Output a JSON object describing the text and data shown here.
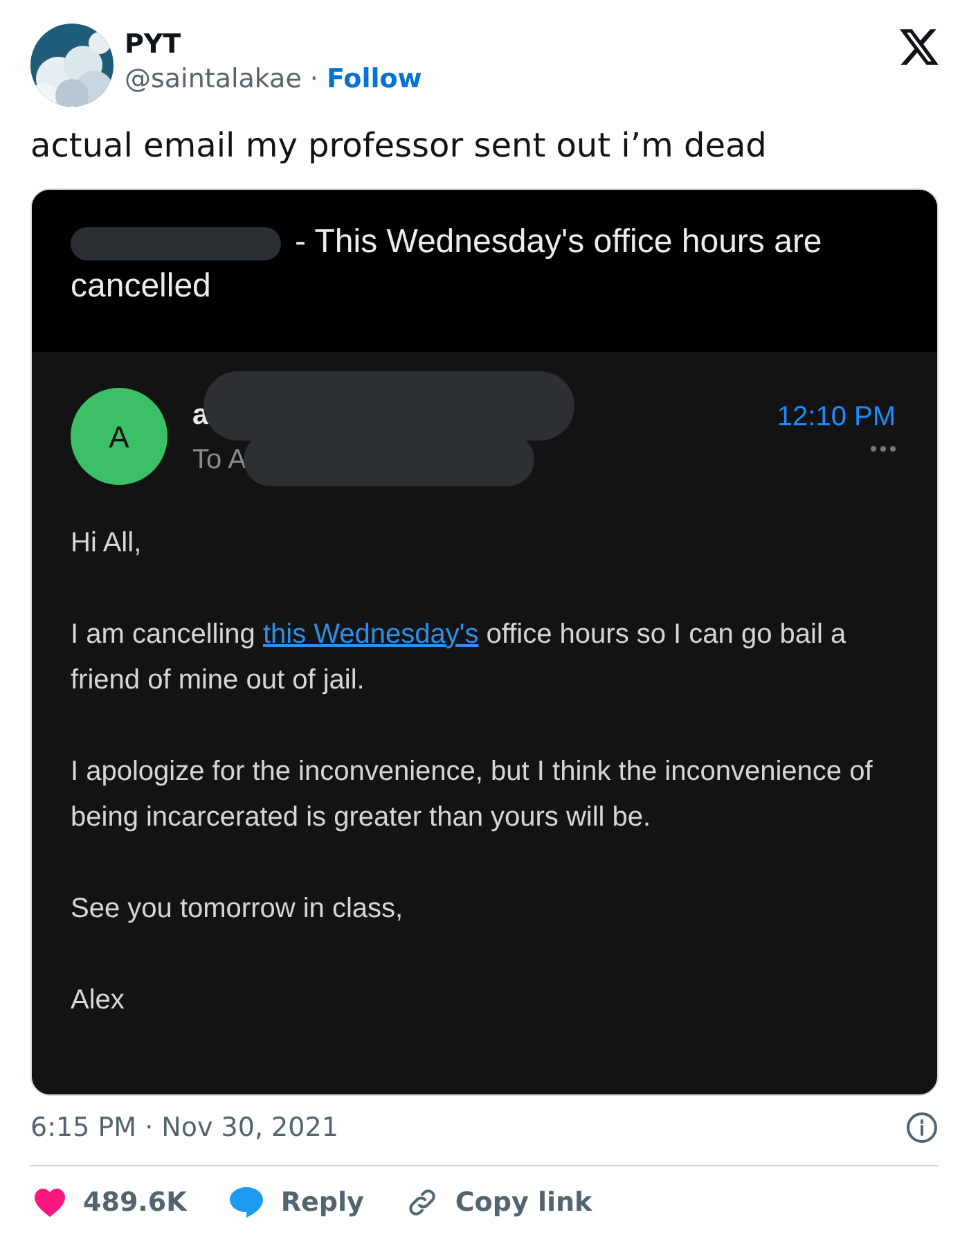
{
  "author": {
    "name": "PYT",
    "handle": "@saintalakae",
    "separator": "·",
    "follow": "Follow"
  },
  "tweet_text": "actual email my professor sent out i’m dead",
  "email": {
    "subject": "- This Wednesday's office hours are cancelled",
    "sender_initial": "A",
    "sender": "a",
    "recipient": "To A",
    "time": "12:10 PM",
    "paragraphs": [
      {
        "kind": "plain",
        "text": "Hi All,"
      },
      {
        "kind": "link",
        "before": "I am cancelling ",
        "link": "this Wednesday's",
        "after": " office hours so I can go bail a friend of mine out of jail."
      },
      {
        "kind": "plain",
        "text": "I apologize for the inconvenience, but I think the inconvenience of being incarcerated is greater than yours will be."
      },
      {
        "kind": "plain",
        "text": "See you tomorrow in class,"
      },
      {
        "kind": "plain",
        "text": "Alex"
      }
    ]
  },
  "timestamp": "6:15 PM · Nov 30, 2021",
  "actions": [
    {
      "kind": "like",
      "label": "489.6K"
    },
    {
      "kind": "reply",
      "label": "Reply"
    },
    {
      "kind": "copy",
      "label": "Copy link"
    }
  ]
}
